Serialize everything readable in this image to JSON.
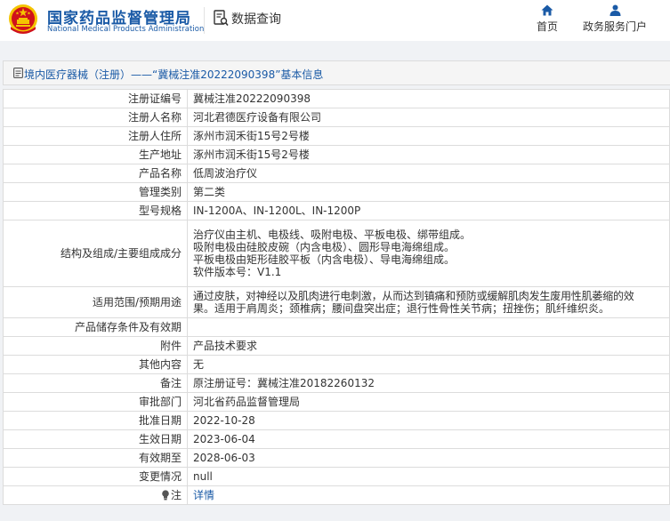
{
  "header": {
    "logo_cn": "国家药品监督管理局",
    "logo_en": "National Medical Products Administration",
    "data_query_label": "数据查询",
    "nav_home": "首页",
    "nav_gov_service": "政务服务门户"
  },
  "title_bar": {
    "text": "境内医疗器械（注册）——“冀械注准20222090398”基本信息"
  },
  "rows": [
    {
      "label": "注册证编号",
      "value": "冀械注准20222090398"
    },
    {
      "label": "注册人名称",
      "value": "河北君德医疗设备有限公司"
    },
    {
      "label": "注册人住所",
      "value": "涿州市润禾街15号2号楼"
    },
    {
      "label": "生产地址",
      "value": "涿州市润禾街15号2号楼"
    },
    {
      "label": "产品名称",
      "value": "低周波治疗仪"
    },
    {
      "label": "管理类别",
      "value": "第二类"
    },
    {
      "label": "型号规格",
      "value": "IN-1200A、IN-1200L、IN-1200P"
    },
    {
      "label": "结构及组成/主要组成成分",
      "lines": [
        "治疗仪由主机、电极线、吸附电极、平板电极、绑带组成。",
        "吸附电极由硅胶皮碗（内含电极）、圆形导电海绵组成。",
        "平板电极由矩形硅胶平板（内含电极）、导电海绵组成。",
        "软件版本号：V1.1"
      ]
    },
    {
      "label": "适用范围/预期用途",
      "lines": [
        "通过皮肤，对神经以及肌肉进行电刺激，从而达到镇痛和预防或缓解肌肉发生废用性肌萎缩的效",
        "果。适用于肩周炎；颈椎病；腰间盘突出症；退行性骨性关节病；扭挫伤；肌纤维织炎。"
      ]
    },
    {
      "label": "产品储存条件及有效期",
      "value": ""
    },
    {
      "label": "附件",
      "value": "产品技术要求"
    },
    {
      "label": "其他内容",
      "value": "无"
    },
    {
      "label": "备注",
      "value": "原注册证号：冀械注准20182260132"
    },
    {
      "label": "审批部门",
      "value": "河北省药品监督管理局"
    },
    {
      "label": "批准日期",
      "value": "2022-10-28"
    },
    {
      "label": "生效日期",
      "value": "2023-06-04"
    },
    {
      "label": "有效期至",
      "value": "2028-06-03"
    },
    {
      "label": "变更情况",
      "value": "null"
    },
    {
      "label": "注",
      "value": "详情"
    }
  ],
  "icons": {
    "emblem": "national-emblem-icon",
    "data_query": "document-search-icon",
    "home": "home-icon",
    "gov_service": "user-icon",
    "title": "document-icon",
    "note": "lightbulb-icon"
  },
  "colors": {
    "brand_blue": "#1a5aa6",
    "emblem_red": "#d0121b",
    "emblem_gold": "#f4c400",
    "border": "#dcdcdc",
    "backdrop": "#f0f2f5"
  }
}
